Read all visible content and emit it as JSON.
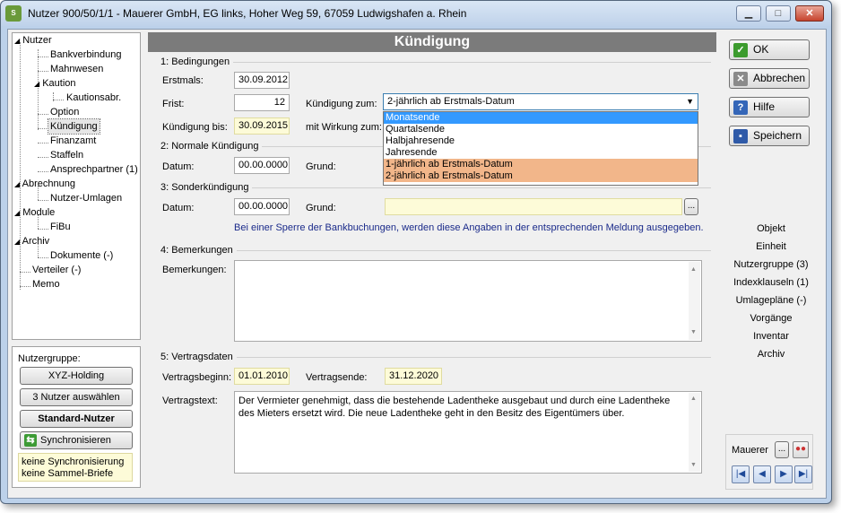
{
  "window": {
    "title": "Nutzer 900/50/1/1 - Mauerer GmbH, EG links, Hoher Weg 59, 67059 Ludwigshafen a. Rhein",
    "app_icon_text": "S"
  },
  "tree": {
    "items": [
      "Nutzer",
      "Bankverbindung",
      "Mahnwesen",
      "Kaution",
      "Kautionsabr.",
      "Option",
      "Kündigung",
      "Finanzamt",
      "Staffeln",
      "Ansprechpartner (1)",
      "Abrechnung",
      "Nutzer-Umlagen",
      "Module",
      "FiBu",
      "Archiv",
      "Dokumente (-)",
      "Verteiler (-)",
      "Memo"
    ]
  },
  "nutzergruppe": {
    "label": "Nutzergruppe:",
    "btn1": "XYZ-Holding",
    "btn2": "3 Nutzer auswählen",
    "btn3": "Standard-Nutzer",
    "btn4": "Synchronisieren",
    "info1": "keine Synchronisierung",
    "info2": "keine Sammel-Briefe"
  },
  "main": {
    "title": "Kündigung",
    "s1": {
      "label": "1: Bedingungen",
      "erstmals_label": "Erstmals:",
      "erstmals": "30.09.2012",
      "frist_label": "Frist:",
      "frist": "12",
      "kz_label": "Kündigung zum:",
      "kz_value": "2-jährlich ab Erstmals-Datum",
      "kb_label": "Kündigung bis:",
      "kb": "30.09.2015",
      "mw_label": "mit Wirkung zum:"
    },
    "dropdown": [
      "Monatsende",
      "Quartalsende",
      "Halbjahresende",
      "Jahresende",
      "1-jährlich ab Erstmals-Datum",
      "2-jährlich ab Erstmals-Datum"
    ],
    "s2": {
      "label": "2: Normale Kündigung",
      "datum_label": "Datum:",
      "datum": "00.00.0000",
      "grund_label": "Grund:"
    },
    "s3": {
      "label": "3: Sonderkündigung",
      "datum_label": "Datum:",
      "datum": "00.00.0000",
      "grund_label": "Grund:",
      "browse": "...",
      "note": "Bei einer Sperre der Bankbuchungen, werden diese Angaben in der entsprechenden Meldung ausgegeben."
    },
    "s4": {
      "label": "4: Bemerkungen",
      "bem_label": "Bemerkungen:"
    },
    "s5": {
      "label": "5: Vertragsdaten",
      "vb_label": "Vertragsbeginn:",
      "vb": "01.01.2010",
      "ve_label": "Vertragsende:",
      "ve": "31.12.2020",
      "vt_label": "Vertragstext:",
      "vt": "Der Vermieter genehmigt, dass die bestehende Ladentheke ausgebaut und durch eine Ladentheke des Mieters ersetzt wird. Die neue Ladentheke geht in den Besitz des Eigentümers über."
    }
  },
  "actions": {
    "ok": "OK",
    "cancel": "Abbrechen",
    "help": "Hilfe",
    "save": "Speichern"
  },
  "links": [
    "Objekt",
    "Einheit",
    "Nutzergruppe (3)",
    "Indexklauseln (1)",
    "Umlagepläne (-)",
    "Vorgänge",
    "Inventar",
    "Archiv"
  ],
  "footer": {
    "user": "Mauerer",
    "browse": "..."
  },
  "colors": {
    "header": "#7b7b7b",
    "highlight": "#3399ff",
    "orange": "#f2b68a",
    "yellow_field": "#fdfbd8",
    "note_text": "#1a2a8a"
  }
}
